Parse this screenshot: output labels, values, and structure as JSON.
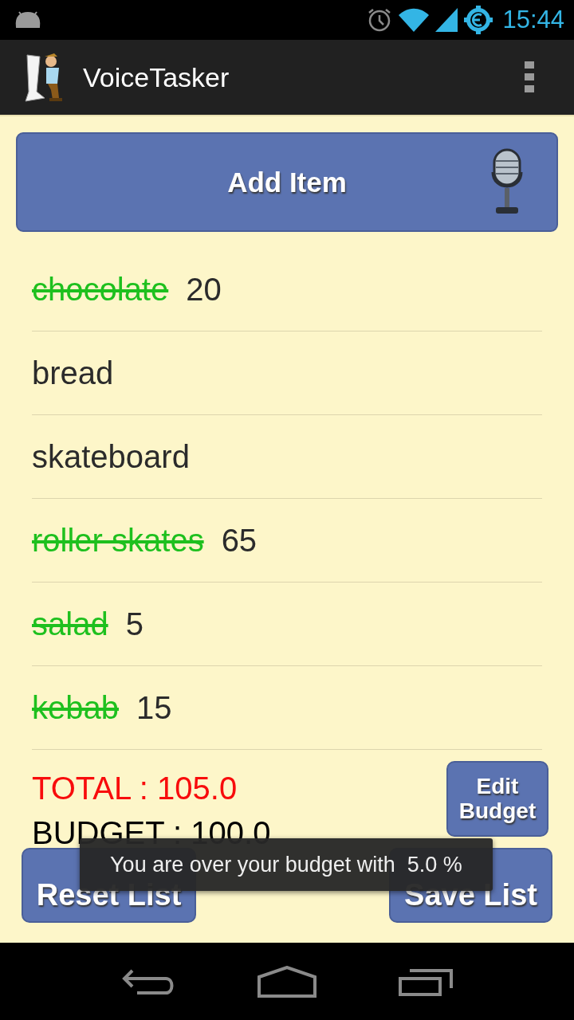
{
  "status_bar": {
    "time": "15:44"
  },
  "app_bar": {
    "title": "VoiceTasker"
  },
  "add_button": {
    "label": "Add Item"
  },
  "items": [
    {
      "name": "chocolate",
      "checked": true,
      "price": "20"
    },
    {
      "name": "bread",
      "checked": false
    },
    {
      "name": "skateboard",
      "checked": false
    },
    {
      "name": "roller skates",
      "checked": true,
      "price": "65"
    },
    {
      "name": "salad",
      "checked": true,
      "price": "5"
    },
    {
      "name": "kebab",
      "checked": true,
      "price": "15"
    }
  ],
  "summary": {
    "total": "TOTAL : 105.0",
    "budget": "BUDGET : 100.0",
    "over_budget": true
  },
  "edit_budget_button": "Edit Budget",
  "buttons": [
    "Reset List",
    "Save List"
  ],
  "toast": "You are over your budget with  5.0 %"
}
